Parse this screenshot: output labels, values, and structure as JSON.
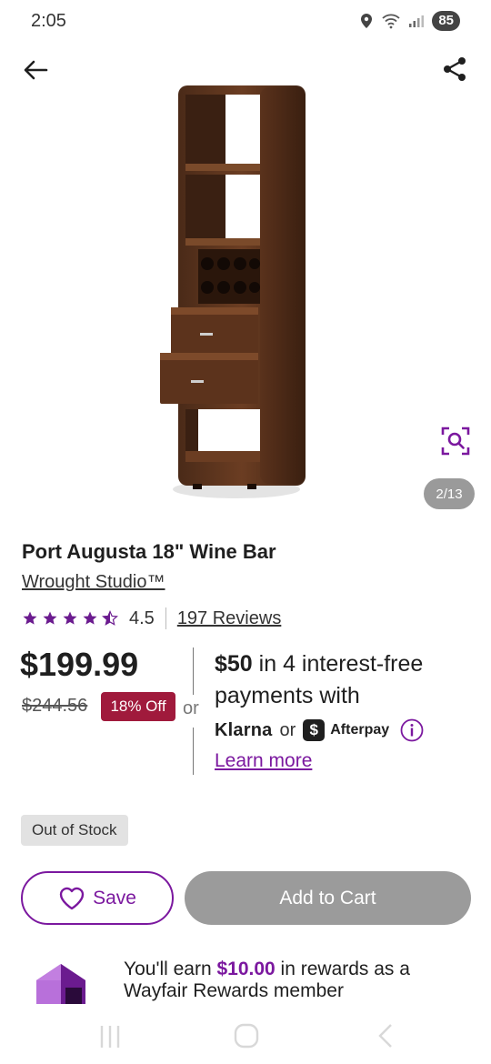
{
  "status_bar": {
    "time": "2:05",
    "battery": "85"
  },
  "nav": {
    "back_icon": "arrow-left-icon",
    "share_icon": "share-icon"
  },
  "gallery": {
    "counter": "2/13",
    "visual_search_icon": "visual-search-icon"
  },
  "product": {
    "title": "Port Augusta 18\" Wine Bar",
    "brand": "Wrought Studio™",
    "rating": "4.5",
    "rating_value": 4.5,
    "reviews": "197 Reviews"
  },
  "pricing": {
    "price": "$199.99",
    "original_price": "$244.56",
    "discount": "18% Off",
    "or": "or"
  },
  "financing": {
    "amount": "$50",
    "text_1": " in 4 interest-free",
    "text_2": "payments",
    "text_3": " with",
    "klarna": "Klarna",
    "or": "or",
    "afterpay_logo": "$",
    "afterpay": "Afterpay",
    "learn_more": "Learn more"
  },
  "stock": {
    "label": "Out of Stock"
  },
  "actions": {
    "save_label": "Save",
    "cart_label": "Add to Cart"
  },
  "rewards": {
    "prefix": "You'll earn ",
    "amount": "$10.00",
    "suffix": " in rewards as a Wayfair Rewards member"
  },
  "colors": {
    "accent": "#7b189f",
    "discount": "#a01a3c",
    "disabled": "#9b9b9b"
  }
}
